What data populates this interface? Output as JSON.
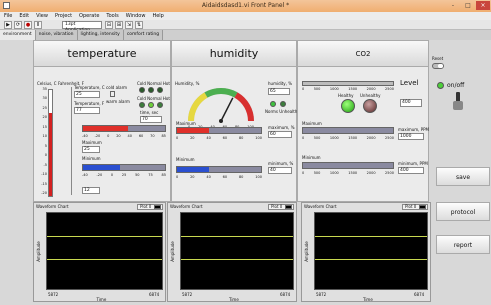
{
  "window": {
    "title": "Aidaidsdasd1.vi Front Panel *",
    "minimize": "-",
    "maximize": "□",
    "close": "×"
  },
  "menu": [
    "File",
    "Edit",
    "View",
    "Project",
    "Operate",
    "Tools",
    "Window",
    "Help"
  ],
  "toolbar": {
    "font": "13pt Application Font"
  },
  "tabs": [
    "environment",
    "noise, vibration",
    "lighting, intensity",
    "comfort rating"
  ],
  "temperature": {
    "title": "temperature",
    "thermo_label": "Celsius, C",
    "thermo_scale": [
      "35",
      "30",
      "25",
      "20",
      "15",
      "10",
      "5",
      "0",
      "-5",
      "-10",
      "-15",
      "-20"
    ],
    "thermo_fill": 0.78,
    "fahrenheit_label": "Fahrenheit, F",
    "temp_c_label": "Temperature, C",
    "temp_c_value": "25",
    "temp_f_label": "Temperature, F",
    "temp_f_value": "77",
    "cold_alarm": "cold alarm",
    "warm_alarm": "warm alarm",
    "cold_normal_hot": "Cold  Normal Hot",
    "cold_normal_hot2": "Cold Normal Hot",
    "time_sec": "time, sec",
    "time_value": "70",
    "max_scale": [
      "-40",
      "-20",
      "0",
      "20",
      "40",
      "60",
      "70",
      "85"
    ],
    "max_label": "Maximum",
    "max_value": "25",
    "max_fill": 0.55,
    "min_label": "Minimum",
    "min_scale": [
      "-40",
      "-20",
      "0",
      "25",
      "50",
      "75",
      "85"
    ],
    "min_value": "12",
    "min_fill": 0.45
  },
  "humidity": {
    "title": "humidity",
    "gauge_label": "Humidity, %",
    "gauge_ticks": [
      "0",
      "20",
      "40",
      "60",
      "80",
      "100"
    ],
    "needle_value": 65,
    "humidity_box_label": "humidity, %",
    "humidity_value": "65",
    "led_labels": "Norms  Unhealthy",
    "max_label": "Maximum",
    "max_value_label": "maximum, %",
    "max_value": "60",
    "max_fill": 0.38,
    "min_label": "Minimum",
    "min_value_label": "minimum, %",
    "min_value": "40",
    "min_fill": 0.38,
    "scale": [
      "0",
      "20",
      "40",
      "60",
      "80",
      "100"
    ]
  },
  "co2": {
    "title": "CO2",
    "level_label": "Level",
    "level_scale": [
      "0",
      "500",
      "1000",
      "1500",
      "2000",
      "2500"
    ],
    "level_value": "400",
    "healthy": "Healthy",
    "unhealthy": "Unhealthy",
    "max_label": "Maximum",
    "max_value_label": "maximum, PPM",
    "max_value": "1000",
    "min_label": "Minimum",
    "min_value_label": "minimum, PPM",
    "min_value": "400",
    "scale": [
      "0",
      "500",
      "1000",
      "1500",
      "2000",
      "2500"
    ]
  },
  "side": {
    "reset": "Reset",
    "onoff": "on/off",
    "save": "save",
    "protocol": "protocol",
    "report": "report"
  },
  "charts": [
    {
      "title": "Waveform Chart",
      "plot": "Plot 0",
      "ylabel": "Amplitude",
      "xlabel": "Time",
      "xmin": "5872",
      "xmax": "6874",
      "line_color": "#c8d850"
    },
    {
      "title": "Waveform Chart",
      "plot": "Plot 0",
      "ylabel": "Amplitude",
      "xlabel": "Time",
      "xmin": "5872",
      "xmax": "6874",
      "line_color": "#c8d850"
    },
    {
      "title": "Waveform Chart",
      "plot": "Plot 0",
      "ylabel": "Amplitude",
      "xlabel": "Time",
      "xmin": "5872",
      "xmax": "6874",
      "line_color": "#c8d850"
    }
  ]
}
